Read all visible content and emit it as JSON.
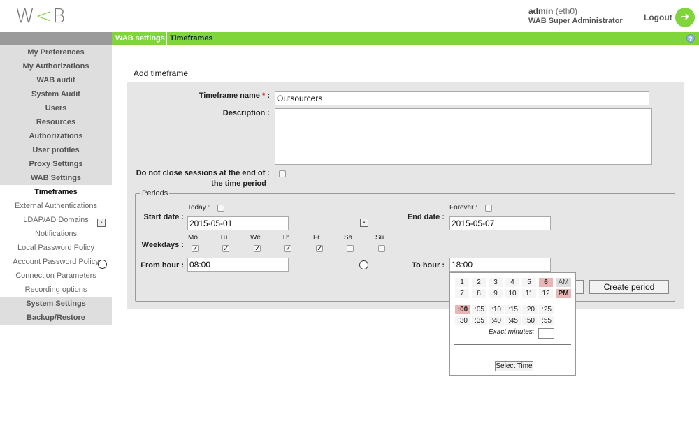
{
  "header": {
    "logo": "WAB",
    "user_name": "admin",
    "user_iface": "(eth0)",
    "user_role": "WAB Super Administrator",
    "logout_label": "Logout",
    "logout_icon": "logout-arrow-icon"
  },
  "breadcrumb": {
    "parent": "WAB settings",
    "current": "Timeframes",
    "help_icon": "help-icon"
  },
  "sidebar": {
    "items": [
      {
        "label": "My Preferences"
      },
      {
        "label": "My Authorizations"
      },
      {
        "label": "WAB audit"
      },
      {
        "label": "System Audit"
      },
      {
        "label": "Users"
      },
      {
        "label": "Resources"
      },
      {
        "label": "Authorizations"
      },
      {
        "label": "User profiles"
      },
      {
        "label": "Proxy Settings"
      },
      {
        "label": "WAB Settings"
      },
      {
        "label": "Timeframes"
      },
      {
        "label": "External Authentications"
      },
      {
        "label": "LDAP/AD Domains"
      },
      {
        "label": "Notifications"
      },
      {
        "label": "Local Password Policy"
      },
      {
        "label": "Account Password Policy"
      },
      {
        "label": "Connection Parameters"
      },
      {
        "label": "Recording options"
      },
      {
        "label": "System Settings"
      },
      {
        "label": "Backup/Restore"
      }
    ]
  },
  "form": {
    "title": "Add timeframe",
    "name_label": "Timeframe name",
    "required_mark": "*",
    "colon": ":",
    "name_value": "Outsourcers",
    "description_label": "Description :",
    "description_value": "",
    "noclose_label_1": "Do not close sessions at the end of :",
    "noclose_label_2": "the time period",
    "periods_legend": "Periods",
    "today_label": "Today :",
    "forever_label": "Forever :",
    "start_date_label": "Start date :",
    "start_date_value": "2015-05-01",
    "end_date_label": "End date :",
    "end_date_value": "2015-05-07",
    "weekdays_label": "Weekdays :",
    "weekdays": [
      {
        "label": "Mo",
        "checked": true
      },
      {
        "label": "Tu",
        "checked": true
      },
      {
        "label": "We",
        "checked": true
      },
      {
        "label": "Th",
        "checked": true
      },
      {
        "label": "Fr",
        "checked": true
      },
      {
        "label": "Sa",
        "checked": false
      },
      {
        "label": "Su",
        "checked": false
      }
    ],
    "from_hour_label": "From hour :",
    "from_hour_value": "08:00",
    "to_hour_label": "To hour :",
    "to_hour_value": "18:00",
    "create_period_label": "Create period"
  },
  "time_picker": {
    "hours_row1": [
      "1",
      "2",
      "3",
      "4",
      "5",
      "6"
    ],
    "hours_row2": [
      "7",
      "8",
      "9",
      "10",
      "11",
      "12"
    ],
    "am": "AM",
    "pm": "PM",
    "selected_hour": "6",
    "selected_period": "PM",
    "minutes_row1": [
      ":00",
      ":05",
      ":10",
      ":15",
      ":20",
      ":25"
    ],
    "minutes_row2": [
      ":30",
      ":35",
      ":40",
      ":45",
      ":50",
      ":55"
    ],
    "selected_minute": ":00",
    "exact_minutes_label": "Exact minutes:",
    "exact_minutes_value": "",
    "select_button": "Select Time"
  }
}
